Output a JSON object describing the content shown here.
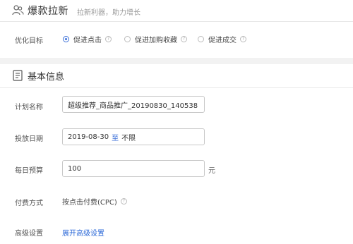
{
  "header": {
    "title": "爆款拉新",
    "subtitle": "拉新利器，助力增长"
  },
  "optimization": {
    "label": "优化目标",
    "options": [
      {
        "label": "促进点击",
        "checked": true
      },
      {
        "label": "促进加购收藏",
        "checked": false
      },
      {
        "label": "促进成交",
        "checked": false
      }
    ]
  },
  "basic_info": {
    "title": "基本信息",
    "plan_name": {
      "label": "计划名称",
      "value": "超级推荐_商品推广_20190830_140538"
    },
    "date": {
      "label": "投放日期",
      "start": "2019-08-30",
      "separator": "至",
      "end": "不限"
    },
    "budget": {
      "label": "每日预算",
      "value": "100",
      "unit": "元"
    },
    "billing": {
      "label": "付费方式",
      "value": "按点击付费(CPC)"
    },
    "advanced": {
      "label": "高级设置",
      "link": "展开高级设置"
    }
  },
  "colors": {
    "accent": "#3b6fd8",
    "link": "#2f6bd8"
  },
  "icons": [
    "users-icon",
    "document-icon",
    "help-icon"
  ]
}
